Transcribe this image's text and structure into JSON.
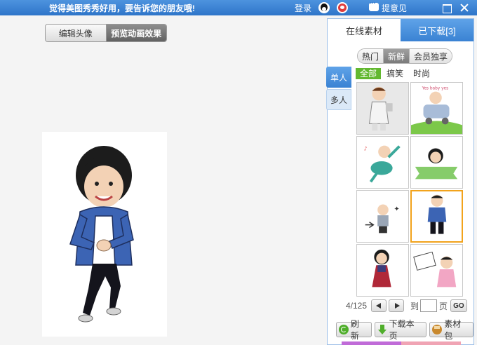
{
  "titlebar": {
    "slogan": "觉得美图秀秀好用，要告诉您的朋友哦!",
    "login": "登录",
    "feedback": "提意见"
  },
  "modes": {
    "edit_label": "编辑头像",
    "preview_label": "预览动画效果"
  },
  "panel": {
    "tabs": {
      "online": "在线素材",
      "downloaded": "已下载[3]"
    },
    "filters": [
      "热门",
      "新鲜",
      "会员独享"
    ],
    "active_filter": "新鲜",
    "side_tabs": {
      "single": "单人",
      "multi": "多人"
    },
    "categories": [
      "全部",
      "搞笑",
      "时尚"
    ],
    "active_category": "全部",
    "thumb_caption": "Yes baby yes",
    "pager": {
      "info": "4/125",
      "to_label": "到",
      "page_label": "页",
      "page_value": "",
      "go_label": "GO"
    },
    "actions": {
      "refresh": "刷新",
      "download_page": "下载本页",
      "pack": "素材包"
    }
  },
  "colors": {
    "titlebar": "#2e75c9",
    "accent_green": "#62b830",
    "selected_border": "#f2a31c",
    "jacket_blue": "#3c64b4"
  }
}
